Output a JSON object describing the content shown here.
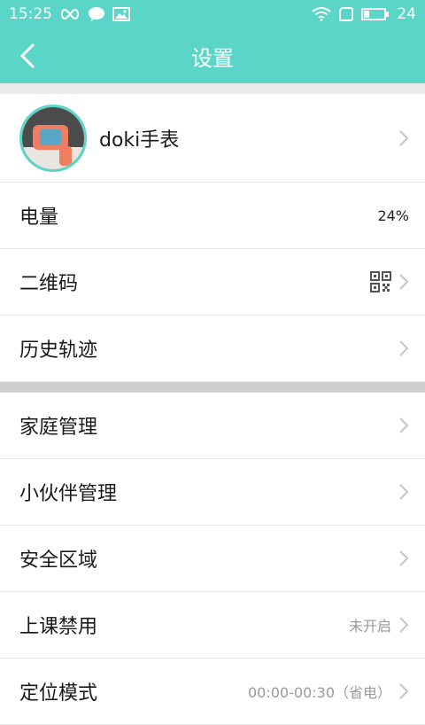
{
  "status_bar": {
    "time": "15:25",
    "battery_level": "24",
    "icons": [
      "infinity-icon",
      "chat-bubble-icon",
      "image-icon",
      "wifi-icon",
      "sim-icon",
      "battery-icon"
    ]
  },
  "header": {
    "title": "设置"
  },
  "device": {
    "name": "doki手表"
  },
  "section1": {
    "items": [
      {
        "label": "电量",
        "value": "24%"
      },
      {
        "label": "二维码",
        "icon": "qr-code-icon"
      },
      {
        "label": "历史轨迹"
      }
    ]
  },
  "section2": {
    "items": [
      {
        "label": "家庭管理"
      },
      {
        "label": "小伙伴管理"
      },
      {
        "label": "安全区域"
      },
      {
        "label": "上课禁用",
        "value": "未开启"
      },
      {
        "label": "定位模式",
        "value": "00:00-00:30（省电）"
      }
    ]
  },
  "colors": {
    "accent": "#5ad5c8",
    "muted_text": "#9a9a9a",
    "divider": "#e6e6e6"
  }
}
